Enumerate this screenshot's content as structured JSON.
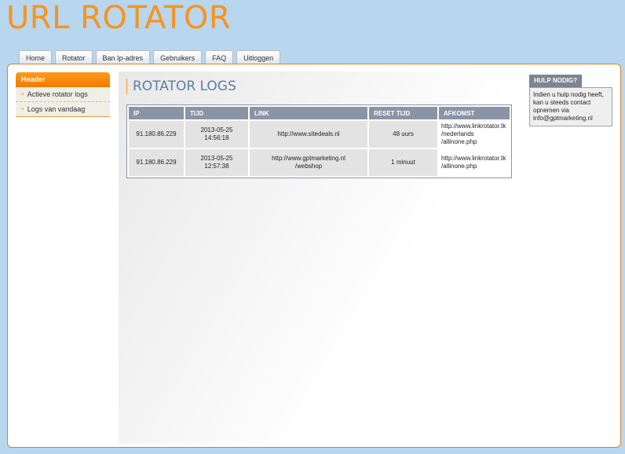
{
  "app": {
    "title": "URL ROTATOR"
  },
  "tabs": [
    {
      "label": "Home"
    },
    {
      "label": "Rotator"
    },
    {
      "label": "Ban Ip-adres"
    },
    {
      "label": "Gebruikers"
    },
    {
      "label": "FAQ"
    },
    {
      "label": "Uitloggen"
    }
  ],
  "sidebar": {
    "header": "Header",
    "items": [
      {
        "label": "Actieve rotator logs"
      },
      {
        "label": "Logs van vandaag"
      }
    ]
  },
  "main": {
    "title": "ROTATOR LOGS",
    "table": {
      "columns": [
        "IP",
        "TIJD",
        "LINK",
        "RESET TIJD",
        "AFKOMST"
      ],
      "rows": [
        {
          "ip": "91.180.86.229",
          "date": "2013-05-25",
          "time": "14:56:18",
          "link": "http://www.sitedeals.nl",
          "reset": "48 uurs",
          "afkomst_1": "http://www.linkrotator.tk",
          "afkomst_2": "/nederlands",
          "afkomst_3": "/allinone.php"
        },
        {
          "ip": "91.180.86.229",
          "date": "2013-05-25",
          "time": "12:57:38",
          "link": "http://www.gptmarketing.nl",
          "link_2": "/webshop",
          "reset": "1 minuut",
          "afkomst_1": "http://www.linkrotator.tk",
          "afkomst_2": "/allinone.php"
        }
      ]
    }
  },
  "help": {
    "title": "HULP NODIG?",
    "text": "Indien u hulp nodig heeft, kan u steeds contact opnemen via info@gptmarketing.nl"
  },
  "colors": {
    "accent": "#f7941d",
    "background": "#b8d6ee",
    "title": "#5b7fa8",
    "table_header": "#8a94a6"
  }
}
